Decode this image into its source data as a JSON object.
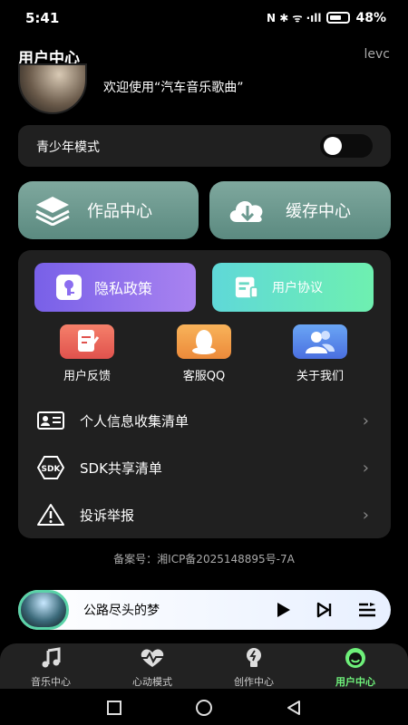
{
  "status": {
    "time": "5:41",
    "icons": "N ✱ ᯤ ·ıll",
    "battery": "48%"
  },
  "header": {
    "title": "用户中心",
    "username": "levc"
  },
  "welcome": "欢迎使用“汽车音乐歌曲”",
  "youth_mode": {
    "label": "青少年模式",
    "enabled": false
  },
  "big_buttons": [
    {
      "label": "作品中心",
      "icon": "layers-icon"
    },
    {
      "label": "缓存中心",
      "icon": "cloud-download-icon"
    }
  ],
  "panel": {
    "privacy": "隐私政策",
    "agreement": "用户协议",
    "tiles": [
      {
        "label": "用户反馈",
        "icon": "feedback-icon",
        "color": "#f06a60"
      },
      {
        "label": "客服QQ",
        "icon": "qq-icon",
        "color": "#f6a84a"
      },
      {
        "label": "关于我们",
        "icon": "about-users-icon",
        "color": "#5b8ef0"
      }
    ],
    "rows": [
      {
        "label": "个人信息收集清单",
        "icon": "id-card-icon"
      },
      {
        "label": "SDK共享清单",
        "icon": "sdk-icon"
      },
      {
        "label": "投诉举报",
        "icon": "warning-icon"
      }
    ]
  },
  "icp": "备案号：湘ICP备2025148895号-7A",
  "player": {
    "song": "公路尽头的梦"
  },
  "tabs": [
    {
      "label": "音乐中心",
      "icon": "music-note-icon"
    },
    {
      "label": "心动模式",
      "icon": "heartbeat-icon"
    },
    {
      "label": "创作中心",
      "icon": "lightbulb-icon"
    },
    {
      "label": "用户中心",
      "icon": "user-center-icon",
      "active": true
    }
  ]
}
